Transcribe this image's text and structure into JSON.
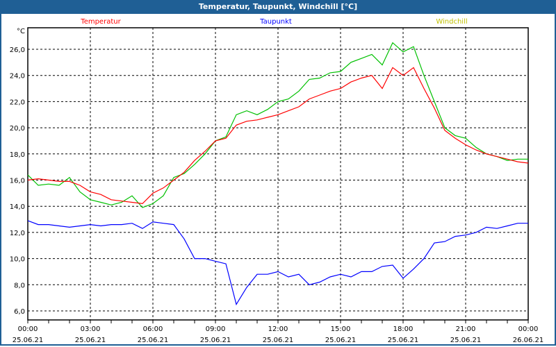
{
  "window": {
    "title": "Temperatur, Taupunkt, Windchill [°C]"
  },
  "chart_data": {
    "type": "line",
    "title": "Temperatur, Taupunkt, Windchill [°C]",
    "ylabel": "°C",
    "ylim": [
      5.3,
      27.7
    ],
    "xlim_hours": [
      0,
      24
    ],
    "grid": true,
    "y_ticks": [
      6,
      8,
      10,
      12,
      14,
      16,
      18,
      20,
      22,
      24,
      26
    ],
    "y_tick_labels": [
      "6,0",
      "8,0",
      "10,0",
      "12,0",
      "14,0",
      "16,0",
      "18,0",
      "20,0",
      "22,0",
      "24,0",
      "26,0"
    ],
    "x_ticks": [
      {
        "hour": 0,
        "time": "00:00",
        "date": "25.06.21"
      },
      {
        "hour": 3,
        "time": "03:00",
        "date": "25.06.21"
      },
      {
        "hour": 6,
        "time": "06:00",
        "date": "25.06.21"
      },
      {
        "hour": 9,
        "time": "09:00",
        "date": "25.06.21"
      },
      {
        "hour": 12,
        "time": "12:00",
        "date": "25.06.21"
      },
      {
        "hour": 15,
        "time": "15:00",
        "date": "25.06.21"
      },
      {
        "hour": 18,
        "time": "18:00",
        "date": "25.06.21"
      },
      {
        "hour": 21,
        "time": "21:00",
        "date": "25.06.21"
      },
      {
        "hour": 24,
        "time": "00:00",
        "date": "26.06.21"
      }
    ],
    "x_step_hours": 0.5,
    "series": [
      {
        "name": "Temperatur",
        "color": "#ff0000",
        "values": [
          16.0,
          16.1,
          16.0,
          15.9,
          15.9,
          15.6,
          15.1,
          14.9,
          14.5,
          14.4,
          14.3,
          14.2,
          15.0,
          15.4,
          16.0,
          16.6,
          17.5,
          18.2,
          19.0,
          19.2,
          20.2,
          20.5,
          20.6,
          20.8,
          21.0,
          21.3,
          21.6,
          22.2,
          22.5,
          22.8,
          23.0,
          23.5,
          23.8,
          24.0,
          23.0,
          24.6,
          24.0,
          24.6,
          23.0,
          21.5,
          19.8,
          19.2,
          18.7,
          18.3,
          18.0,
          17.8,
          17.6,
          17.4,
          17.3
        ]
      },
      {
        "name": "Taupunkt",
        "color": "#0000ff",
        "values": [
          12.9,
          12.6,
          12.6,
          12.5,
          12.4,
          12.5,
          12.6,
          12.5,
          12.6,
          12.6,
          12.7,
          12.3,
          12.8,
          12.7,
          12.6,
          11.5,
          10.0,
          10.0,
          9.8,
          9.6,
          6.5,
          7.8,
          8.8,
          8.8,
          9.0,
          8.6,
          8.8,
          8.0,
          8.2,
          8.6,
          8.8,
          8.6,
          9.0,
          9.0,
          9.4,
          9.5,
          8.5,
          9.2,
          10.0,
          11.2,
          11.3,
          11.7,
          11.8,
          12.0,
          12.4,
          12.3,
          12.5,
          12.7,
          12.7
        ]
      },
      {
        "name": "Windchill",
        "color": "#00c000",
        "values": [
          16.4,
          15.6,
          15.7,
          15.6,
          16.2,
          15.1,
          14.5,
          14.3,
          14.1,
          14.3,
          14.8,
          13.9,
          14.2,
          14.8,
          16.2,
          16.5,
          17.2,
          18.0,
          19.0,
          19.3,
          21.0,
          21.3,
          21.0,
          21.4,
          22.0,
          22.2,
          22.8,
          23.7,
          23.8,
          24.2,
          24.3,
          25.0,
          25.3,
          25.6,
          24.8,
          26.5,
          25.8,
          26.2,
          24.0,
          22.0,
          20.0,
          19.4,
          19.2,
          18.5,
          18.0,
          17.8,
          17.5,
          17.6,
          17.6
        ]
      }
    ],
    "legend": [
      "Temperatur",
      "Taupunkt",
      "Windchill"
    ],
    "legend_colors": [
      "#ff0000",
      "#0000ff",
      "#c0c000"
    ],
    "legend_placement": "top"
  }
}
